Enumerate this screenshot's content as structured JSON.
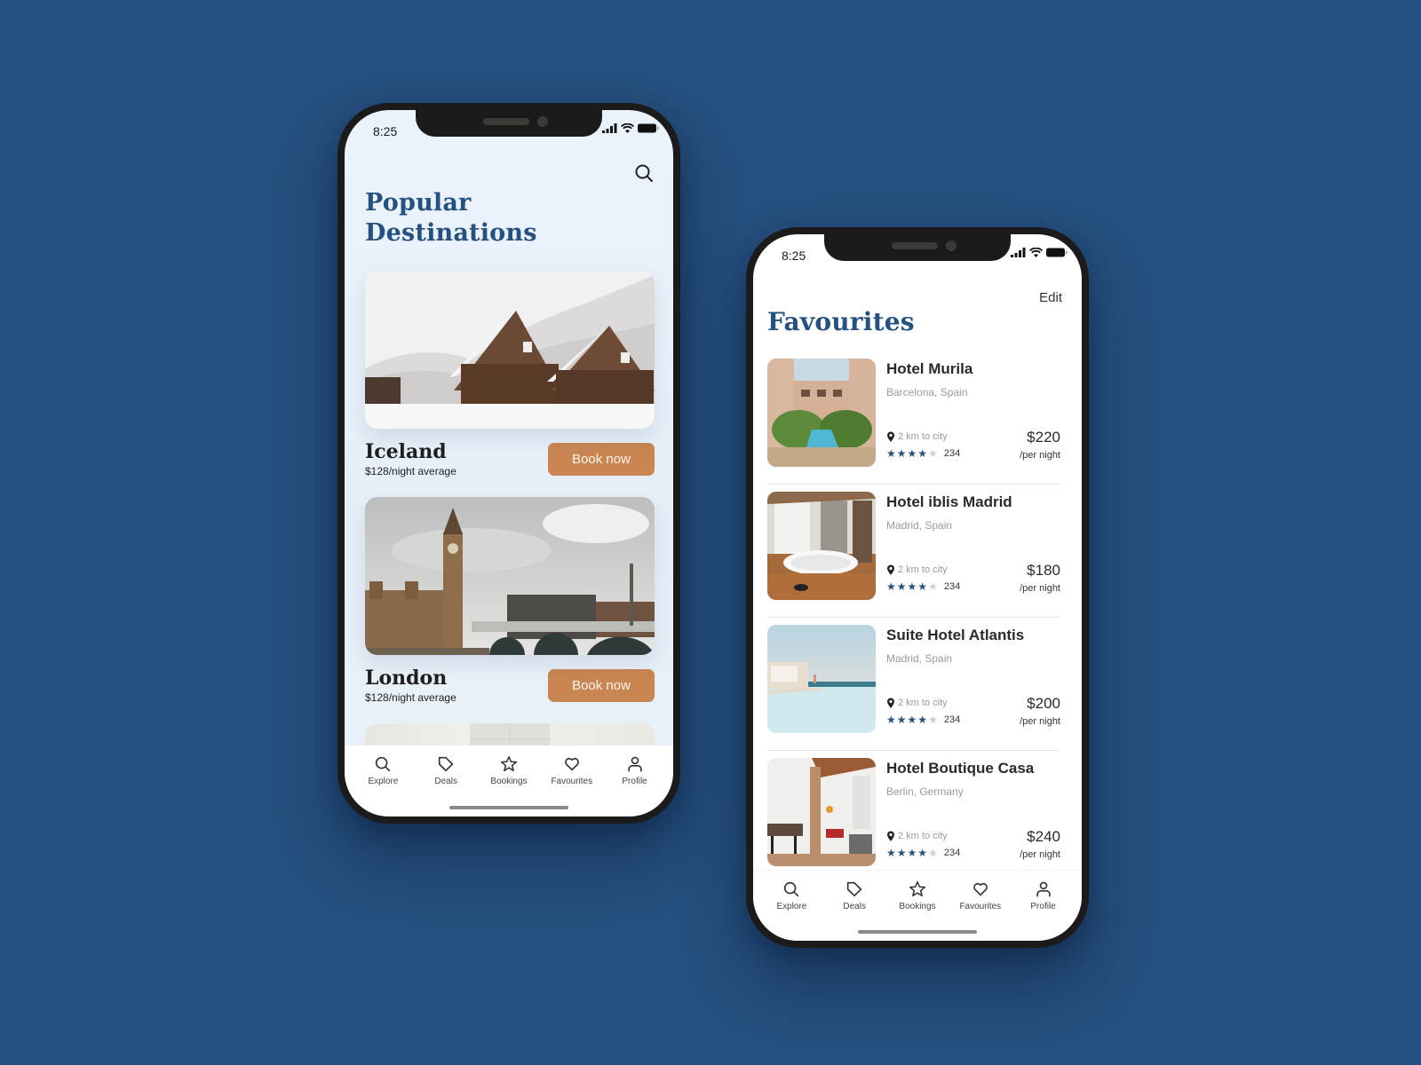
{
  "colors": {
    "background": "#26507f",
    "title": "#26507f",
    "accent_button": "#c98552",
    "star_filled": "#26507f",
    "star_empty": "#cfcfcf"
  },
  "phones": {
    "destinations": {
      "status_time": "8:25",
      "status_icons": [
        "signal-icon",
        "wifi-icon",
        "battery-icon"
      ],
      "search_icon": "search-icon",
      "title": "Popular Destinations",
      "destinations": [
        {
          "name": "Iceland",
          "price": "$128/night average",
          "button": "Book now",
          "image": "snowy-village-photo"
        },
        {
          "name": "London",
          "price": "$128/night average",
          "button": "Book now",
          "image": "big-ben-westminster-photo"
        }
      ],
      "tabs": [
        {
          "label": "Explore",
          "icon": "search-icon"
        },
        {
          "label": "Deals",
          "icon": "tag-icon"
        },
        {
          "label": "Bookings",
          "icon": "star-icon"
        },
        {
          "label": "Favourites",
          "icon": "heart-icon"
        },
        {
          "label": "Profile",
          "icon": "user-icon"
        }
      ]
    },
    "favourites": {
      "status_time": "8:25",
      "status_icons": [
        "signal-icon",
        "wifi-icon",
        "battery-icon"
      ],
      "edit_label": "Edit",
      "title": "Favourites",
      "hotels": [
        {
          "name": "Hotel Murila",
          "location": "Barcelona, Spain",
          "distance": "2 km to city",
          "rating": 4,
          "max_rating": 5,
          "reviews": "234",
          "price": "$220",
          "per": "/per night",
          "image": "courtyard-pool-photo"
        },
        {
          "name": "Hotel iblis Madrid",
          "location": "Madrid, Spain",
          "distance": "2 km to city",
          "rating": 4,
          "max_rating": 5,
          "reviews": "234",
          "price": "$180",
          "per": "/per night",
          "image": "jacuzzi-room-photo"
        },
        {
          "name": "Suite Hotel Atlantis",
          "location": "Madrid, Spain",
          "distance": "2 km to city",
          "rating": 4,
          "max_rating": 5,
          "reviews": "234",
          "price": "$200",
          "per": "/per night",
          "image": "infinity-pool-photo"
        },
        {
          "name": "Hotel Boutique Casa",
          "location": "Berlin, Germany",
          "distance": "2 km to city",
          "rating": 4,
          "max_rating": 5,
          "reviews": "234",
          "price": "$240",
          "per": "/per night",
          "image": "boutique-interior-photo"
        }
      ],
      "tabs": [
        {
          "label": "Explore",
          "icon": "search-icon"
        },
        {
          "label": "Deals",
          "icon": "tag-icon"
        },
        {
          "label": "Bookings",
          "icon": "star-icon"
        },
        {
          "label": "Favourites",
          "icon": "heart-icon"
        },
        {
          "label": "Profile",
          "icon": "user-icon"
        }
      ]
    }
  }
}
